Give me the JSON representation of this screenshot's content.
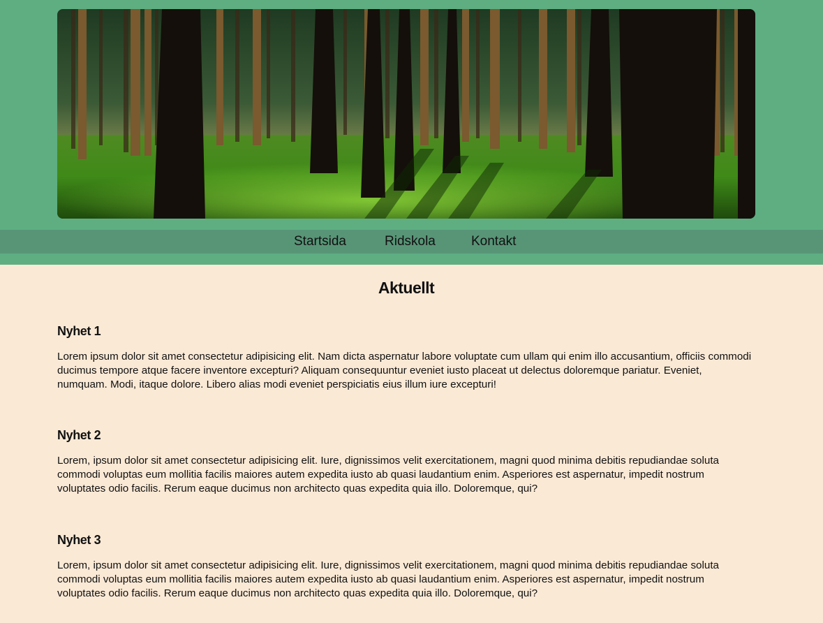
{
  "hero_image": {
    "description": "forest-photo"
  },
  "nav": {
    "items": [
      {
        "label": "Startsida"
      },
      {
        "label": "Ridskola"
      },
      {
        "label": "Kontakt"
      }
    ]
  },
  "main": {
    "title": "Aktuellt",
    "articles": [
      {
        "title": "Nyhet 1",
        "body": "Lorem ipsum dolor sit amet consectetur adipisicing elit. Nam dicta aspernatur labore voluptate cum ullam qui enim illo accusantium, officiis commodi ducimus tempore atque facere inventore excepturi? Aliquam consequuntur eveniet iusto placeat ut delectus doloremque pariatur. Eveniet, numquam. Modi, itaque dolore. Libero alias modi eveniet perspiciatis eius illum iure excepturi!"
      },
      {
        "title": "Nyhet 2",
        "body": "Lorem, ipsum dolor sit amet consectetur adipisicing elit. Iure, dignissimos velit exercitationem, magni quod minima debitis repudiandae soluta commodi voluptas eum mollitia facilis maiores autem expedita iusto ab quasi laudantium enim. Asperiores est aspernatur, impedit nostrum voluptates odio facilis. Rerum eaque ducimus non architecto quas expedita quia illo. Doloremque, qui?"
      },
      {
        "title": "Nyhet 3",
        "body": "Lorem, ipsum dolor sit amet consectetur adipisicing elit. Iure, dignissimos velit exercitationem, magni quod minima debitis repudiandae soluta commodi voluptas eum mollitia facilis maiores autem expedita iusto ab quasi laudantium enim. Asperiores est aspernatur, impedit nostrum voluptates odio facilis. Rerum eaque ducimus non architecto quas expedita quia illo. Doloremque, qui?"
      }
    ]
  },
  "colors": {
    "header_bg": "#5eae82",
    "nav_bg": "#589577",
    "page_bg": "#fae9d5"
  }
}
